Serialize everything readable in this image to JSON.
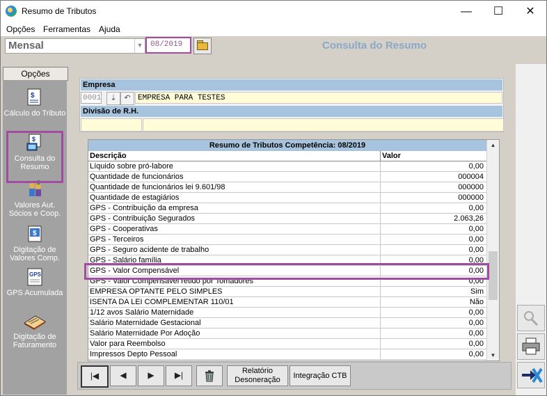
{
  "window": {
    "title": "Resumo de Tributos"
  },
  "menu": [
    "Opções",
    "Ferramentas",
    "Ajuda"
  ],
  "toolbar": {
    "period_type": "Mensal",
    "period": "08/2019",
    "heading": "Consulta do Resumo"
  },
  "sidebar": {
    "header": "Opções",
    "items": [
      {
        "label": "Cálculo do Tributo",
        "icon": "calculator-document-icon"
      },
      {
        "label": "Consulta do Resumo",
        "icon": "computer-document-icon"
      },
      {
        "label": "Valores Aut. Sócios e Coop.",
        "icon": "people-money-icon"
      },
      {
        "label": "Digitação de Valores Comp.",
        "icon": "money-document-icon"
      },
      {
        "label": "GPS Acumulada",
        "icon": "gps-document-icon"
      },
      {
        "label": "Digitação de Faturamento",
        "icon": "notebook-icon"
      }
    ]
  },
  "empresa": {
    "label": "Empresa",
    "code": "0001",
    "name": "EMPRESA PARA TESTES",
    "divisao_label": "Divisão de R.H."
  },
  "grid": {
    "title": "Resumo de Tributos Competência: 08/2019",
    "headers": [
      "Descrição",
      "Valor"
    ],
    "rows": [
      {
        "desc": "Líquido sobre pró-labore",
        "value": "0,00"
      },
      {
        "desc": "Quantidade de funcionários",
        "value": "000004"
      },
      {
        "desc": "Quantidade de funcionários lei 9.601/98",
        "value": "000000"
      },
      {
        "desc": "Quantidade de estagiários",
        "value": "000000"
      },
      {
        "desc": "GPS - Contribuição da empresa",
        "value": "0,00"
      },
      {
        "desc": "GPS - Contribuição Segurados",
        "value": "2.063,26"
      },
      {
        "desc": "GPS - Cooperativas",
        "value": "0,00"
      },
      {
        "desc": "GPS - Terceiros",
        "value": "0,00"
      },
      {
        "desc": "GPS - Seguro acidente de trabalho",
        "value": "0,00"
      },
      {
        "desc": "GPS - Salário família",
        "value": "0,00"
      },
      {
        "desc": "GPS - Valor Compensável",
        "value": "0,00"
      },
      {
        "desc": "GPS - Valor Compensável retido por Tomadores",
        "value": "0,00"
      },
      {
        "desc": "EMPRESA OPTANTE PELO SIMPLES",
        "value": "Sim"
      },
      {
        "desc": "ISENTA DA LEI COMPLEMENTAR 110/01",
        "value": "Não"
      },
      {
        "desc": "1/12 avos Salário Maternidade",
        "value": "0,00"
      },
      {
        "desc": "Salário Maternidade Gestacional",
        "value": "0,00"
      },
      {
        "desc": "Salário Maternidade Por Adoção",
        "value": "0,00"
      },
      {
        "desc": "Valor para Reembolso",
        "value": "0,00"
      },
      {
        "desc": "Impressos Depto Pessoal",
        "value": "0,00"
      }
    ]
  },
  "navbar": {
    "first": "|◀",
    "prev": "◀",
    "next": "▶",
    "last": "▶|",
    "relatorio_line1": "Relatório",
    "relatorio_line2": "Desoneração",
    "integracao": "Integração CTB"
  }
}
